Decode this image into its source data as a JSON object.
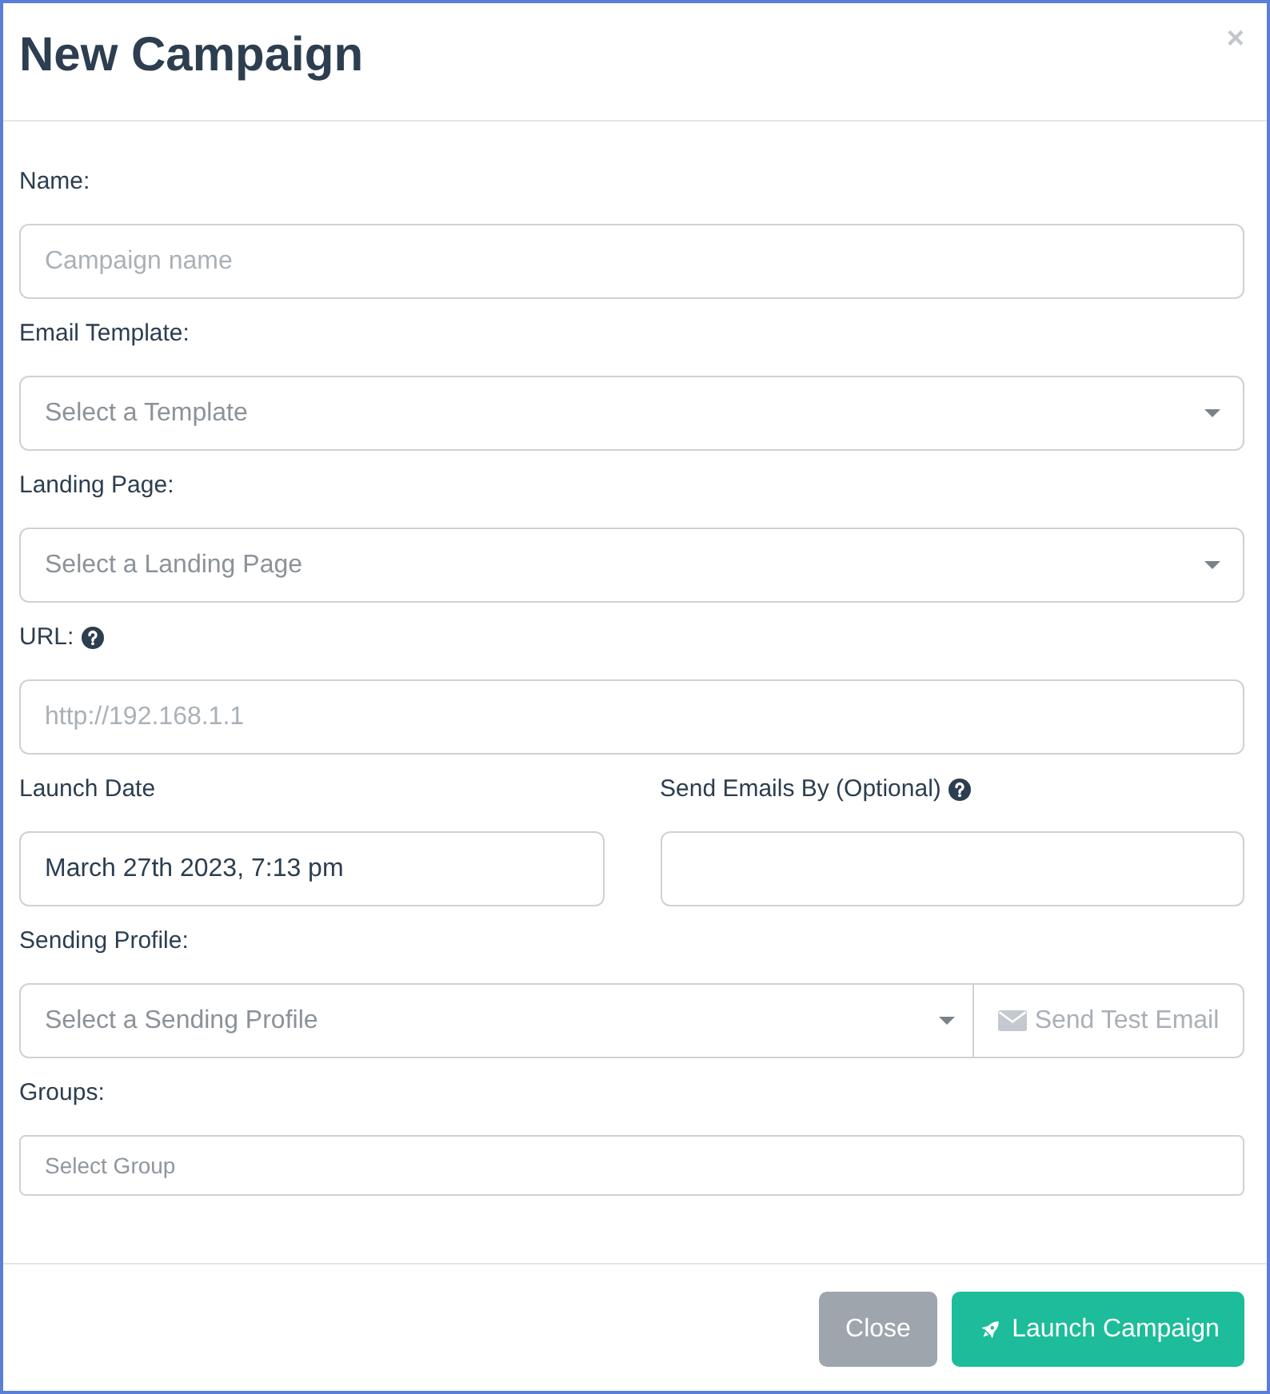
{
  "modal": {
    "title": "New Campaign",
    "close_label": "×"
  },
  "form_rows": [
    {
      "fields": [
        {
          "kind": "text",
          "label": "Name:",
          "help_icon": false,
          "placeholder": "Campaign name"
        }
      ]
    },
    {
      "fields": [
        {
          "kind": "select",
          "label": "Email Template:",
          "help_icon": false,
          "placeholder": "Select a Template"
        }
      ]
    },
    {
      "fields": [
        {
          "kind": "select",
          "label": "Landing Page:",
          "help_icon": false,
          "placeholder": "Select a Landing Page"
        }
      ]
    },
    {
      "fields": [
        {
          "kind": "text",
          "label": "URL:",
          "help_icon": true,
          "placeholder": "http://192.168.1.1"
        }
      ]
    },
    {
      "fields": [
        {
          "kind": "text",
          "label": "Launch Date",
          "help_icon": false,
          "value": "March 27th 2023, 7:13 pm"
        },
        {
          "kind": "text",
          "label": "Send Emails By (Optional)",
          "help_icon": true
        }
      ]
    },
    {
      "fields": [
        {
          "kind": "select_with_button",
          "label": "Sending Profile:",
          "help_icon": false,
          "placeholder": "Select a Sending Profile",
          "button": {
            "label": "Send Test Email",
            "disabled": true
          }
        }
      ]
    },
    {
      "fields": [
        {
          "kind": "tags",
          "label": "Groups:",
          "help_icon": false,
          "placeholder": "Select Group"
        }
      ]
    }
  ],
  "footer_buttons": [
    {
      "kind": "secondary",
      "label": "Close"
    },
    {
      "kind": "primary",
      "label": "Launch Campaign"
    }
  ]
}
